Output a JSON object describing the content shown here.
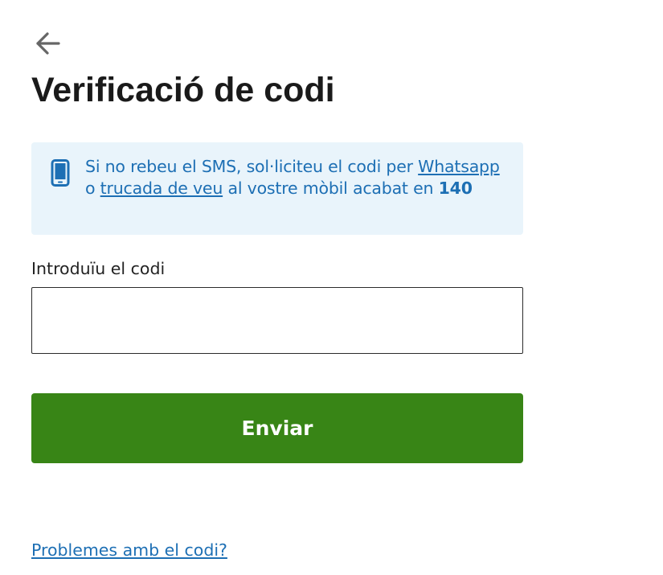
{
  "header": {
    "back_icon": "arrow-left-icon",
    "title": "Verificació de codi"
  },
  "info": {
    "icon": "mobile-phone-icon",
    "text_before": "Si no rebeu el SMS, sol·liciteu el codi per ",
    "whatsapp_link": "Whatsapp",
    "text_between": " o ",
    "voice_call_link": "trucada de veu",
    "text_after": " al vostre mòbil acabat en ",
    "phone_suffix": "140"
  },
  "form": {
    "code_label": "Introduïu el codi",
    "code_value": "",
    "code_placeholder": "",
    "submit_label": "Enviar"
  },
  "footer": {
    "help_link": "Problemes amb el codi?"
  },
  "colors": {
    "primary_button": "#388516",
    "link": "#1d6fb4",
    "info_background": "#e9f4fb"
  }
}
